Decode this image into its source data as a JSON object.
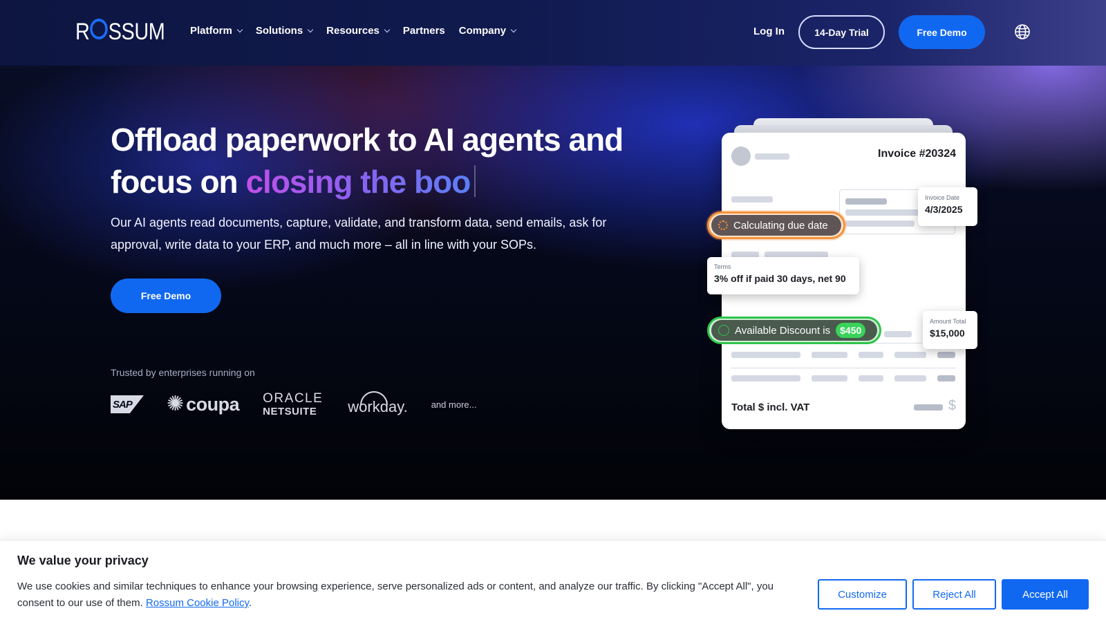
{
  "brand": {
    "name_left": "R",
    "name_right": "SSUM",
    "accent": "#1a6cff"
  },
  "nav": {
    "items": [
      {
        "label": "Platform",
        "dropdown": true
      },
      {
        "label": "Solutions",
        "dropdown": true
      },
      {
        "label": "Resources",
        "dropdown": true
      },
      {
        "label": "Partners",
        "dropdown": false
      },
      {
        "label": "Company",
        "dropdown": true
      }
    ],
    "login": "Log In",
    "trial": "14-Day Trial",
    "demo": "Free Demo",
    "language_icon": "globe-icon"
  },
  "hero": {
    "headline_line1": "Offload paperwork to AI agents and",
    "headline_line2_plain": "focus on ",
    "headline_line2_grad": "closing the boo",
    "subtext": "Our AI agents read documents, capture, validate, and transform data, send emails, ask for approval, write data to your ERP, and much more – all in line with your SOPs.",
    "cta": "Free Demo",
    "trusted_label": "Trusted by enterprises running on",
    "partner_logos": {
      "sap": "SAP",
      "coupa": "coupa",
      "oracle_line1": "ORACLE",
      "oracle_line2": "NETSUITE",
      "workday": "workday."
    },
    "and_more": "and more..."
  },
  "invoice": {
    "number": "Invoice #20324",
    "invoice_date_label": "Invoice Date",
    "invoice_date_value": "4/3/2025",
    "calculating": "Calculating due date",
    "terms_label": "Terms",
    "terms_value": "3% off if paid 30 days, net 90",
    "discount_text": "Available Discount is",
    "discount_amount": "$450",
    "amount_total_label": "Amount Total",
    "amount_total_value": "$15,000",
    "total_label": "Total $ incl. VAT",
    "total_symbol": "$"
  },
  "cookie": {
    "title": "We value your privacy",
    "text": "We use cookies and similar techniques to enhance your browsing experience, serve personalized ads or content, and analyze our traffic. By clicking \"Accept All\", you consent to our use of them. ",
    "link": "Rossum Cookie Policy",
    "period": ".",
    "customize": "Customize",
    "reject": "Reject All",
    "accept": "Accept All"
  }
}
